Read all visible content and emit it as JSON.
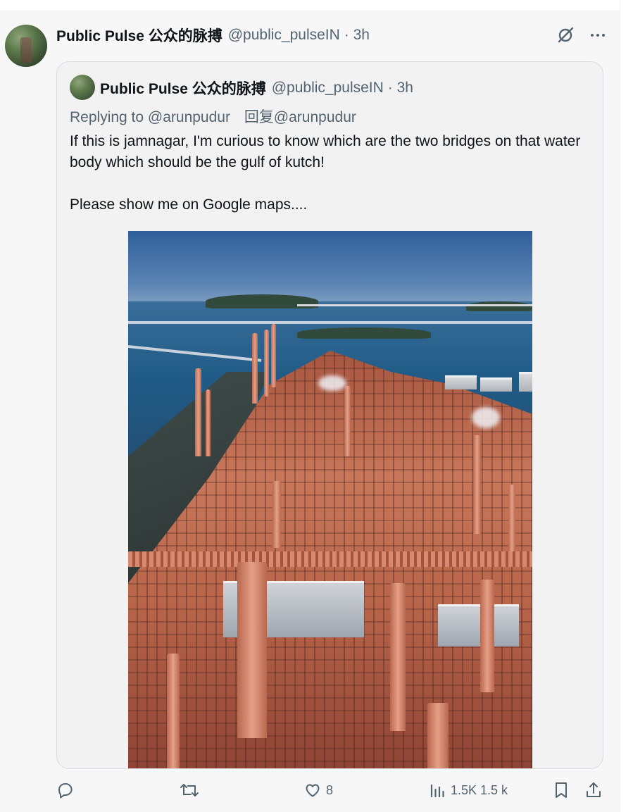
{
  "post": {
    "author_name": "Public Pulse 公众的脉搏",
    "author_handle": "@public_pulseIN",
    "time": "· 3h",
    "icons": [
      "grok-icon",
      "more-icon"
    ]
  },
  "quote": {
    "author_name": "Public Pulse 公众的脉搏",
    "author_handle": "@public_pulseIN",
    "time": "· 3h",
    "replying_to": "Replying to @arunpudur",
    "replying_to_cn": "回复@arunpudur",
    "text_paragraph_1": "If this is jamnagar, I'm curious to know which are the two bridges on that water body which should be the gulf of kutch!",
    "text_paragraph_2": "Please show me on Google maps....",
    "media_description_icon": "industrial-refinery-image"
  },
  "actions": {
    "reply_count": "",
    "repost_count": "",
    "like_count": "8",
    "views_count": "1.5K 1.5 k"
  },
  "colors": {
    "text_primary": "#0f1419",
    "text_secondary": "#536471",
    "background": "#f7f7f7",
    "quote_background": "#f2f2f2"
  }
}
